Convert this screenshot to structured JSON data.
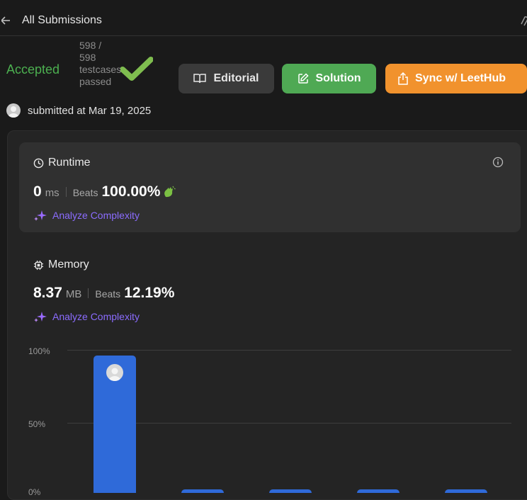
{
  "header": {
    "title": "All Submissions"
  },
  "status": {
    "result": "Accepted",
    "testcases_lines": [
      "598 /",
      "598",
      "testcases",
      "passed"
    ],
    "submitted_text": "submitted at Mar 19, 2025"
  },
  "buttons": {
    "editorial": "Editorial",
    "solution": "Solution",
    "sync": "Sync w/ LeetHub"
  },
  "runtime": {
    "title": "Runtime",
    "value": "0",
    "unit": "ms",
    "beats_label": "Beats",
    "beats_value": "100.00%",
    "analyze": "Analyze Complexity"
  },
  "memory": {
    "title": "Memory",
    "value": "8.37",
    "unit": "MB",
    "beats_label": "Beats",
    "beats_value": "12.19%",
    "analyze": "Analyze Complexity"
  },
  "chart_data": {
    "type": "bar",
    "ytick_labels": [
      "100%",
      "50%",
      "0%"
    ],
    "values": [
      96,
      null,
      null,
      null,
      null
    ],
    "ylim": [
      0,
      100
    ],
    "grid": true,
    "colors": {
      "bar": "#2f6ad9"
    }
  },
  "colors": {
    "accepted": "#4cb050",
    "solution_button": "#4fa954",
    "sync_button": "#f1922d",
    "analyze_link": "#8b6cff"
  }
}
